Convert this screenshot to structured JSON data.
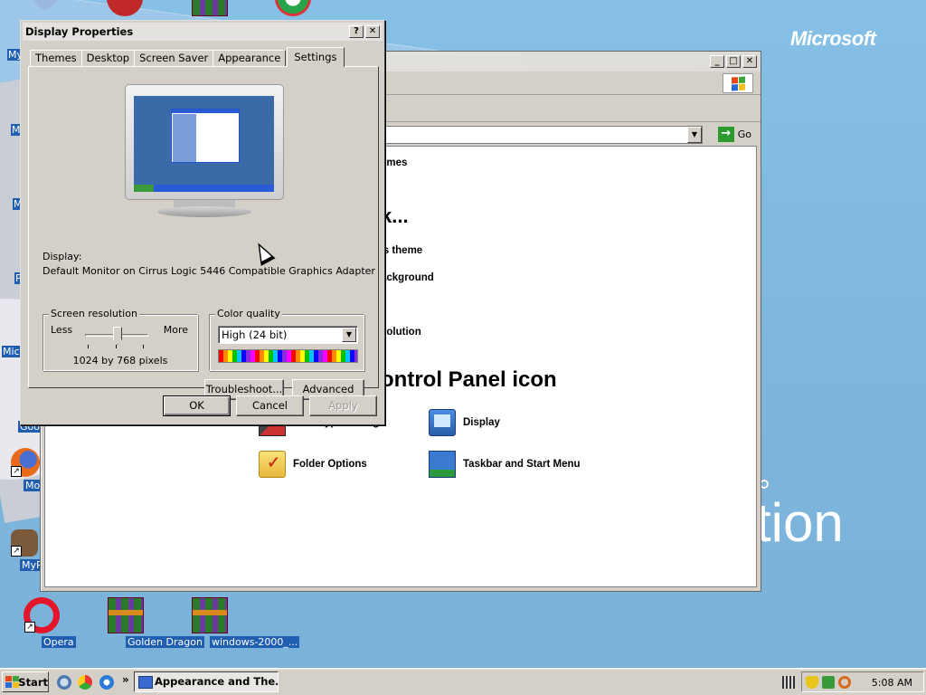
{
  "desktop": {
    "brand": "Microsoft",
    "brand_tail": "tion",
    "icons": [
      {
        "label": "Google",
        "partial": true
      },
      {
        "label": "Mozilla",
        "partial": true
      },
      {
        "label": "MyPa",
        "partial": true
      },
      {
        "label": "Opera"
      },
      {
        "label": "Golden Dragon"
      },
      {
        "label": "windows-2000_..."
      }
    ],
    "left_labels": [
      "My",
      "M",
      "M",
      "P",
      "Micr"
    ]
  },
  "control_panel": {
    "go_label": "Go",
    "fragments": [
      "emes",
      "k...",
      "'s theme",
      "ackground",
      "r",
      "solution"
    ],
    "heading_fragment": "ontrol Panel icon",
    "icons": [
      {
        "label": "ClearType Tuning",
        "icon": "cleartype-icon"
      },
      {
        "label": "Display",
        "icon": "display-icon"
      },
      {
        "label": "Folder Options",
        "icon": "folder-options-icon"
      },
      {
        "label": "Taskbar and Start Menu",
        "icon": "taskbar-icon"
      }
    ]
  },
  "dialog": {
    "title": "Display Properties",
    "help_btn": "?",
    "close_btn": "✕",
    "tabs": [
      "Themes",
      "Desktop",
      "Screen Saver",
      "Appearance",
      "Settings"
    ],
    "active_tab": "Settings",
    "display_label": "Display:",
    "display_value": "Default Monitor on Cirrus Logic 5446 Compatible Graphics Adapter",
    "resolution": {
      "group_title": "Screen resolution",
      "less": "Less",
      "more": "More",
      "value": "1024 by 768 pixels",
      "slider_level": 0.5
    },
    "color": {
      "group_title": "Color quality",
      "selected": "High (24 bit)"
    },
    "buttons": {
      "troubleshoot": "Troubleshoot...",
      "advanced": "Advanced",
      "ok": "OK",
      "cancel": "Cancel",
      "apply": "Apply"
    }
  },
  "taskbar": {
    "start": "Start",
    "chevron": "»",
    "task_item": "Appearance and The...",
    "clock": "5:08 AM"
  },
  "colors": {
    "desktop_bg": "#7fb6dc",
    "dialog_bg": "#d4d0c8",
    "icon_label_bg": "#1f5eb0"
  }
}
